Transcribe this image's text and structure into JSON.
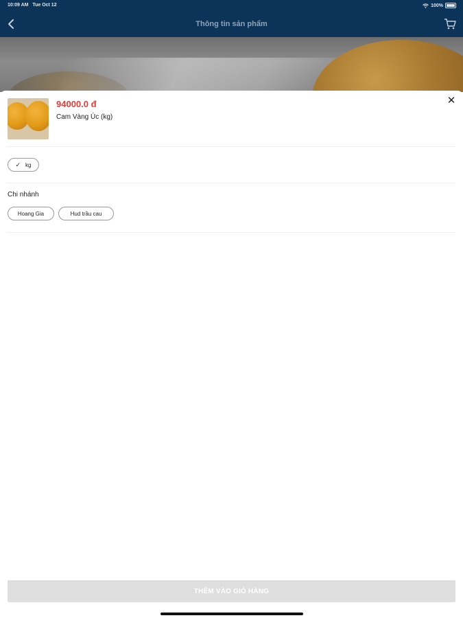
{
  "status_bar": {
    "time": "10:09 AM",
    "date": "Tue Oct 12",
    "battery": "100%"
  },
  "nav": {
    "title": "Thông tin sản phẩm",
    "back_icon": "chevron-left-icon",
    "cart_icon": "cart-icon"
  },
  "product": {
    "price": "94000.0 đ",
    "name": "Cam Vàng Úc (kg)",
    "thumbnail_icon": "orange-product-image"
  },
  "unit": {
    "label": "kg",
    "selected": true
  },
  "branch": {
    "label": "Chi nhánh",
    "options": [
      "Hoang Gia",
      "Hud trầu cau"
    ]
  },
  "actions": {
    "add_to_cart": "THÊM VÀO GIỎ HÀNG"
  },
  "colors": {
    "nav_bg": "#0c3358",
    "price": "#e53935",
    "button_disabled": "#dedede"
  }
}
